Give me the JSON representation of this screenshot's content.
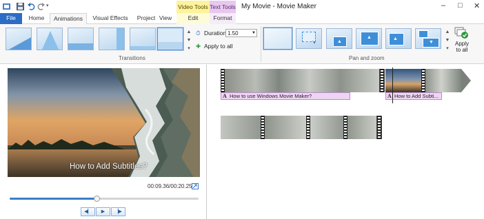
{
  "window": {
    "title": "My Movie - Movie Maker",
    "contextual": {
      "video_tools": "Video Tools",
      "text_tools": "Text Tools"
    }
  },
  "tabs": [
    {
      "label": "File"
    },
    {
      "label": "Home"
    },
    {
      "label": "Animations"
    },
    {
      "label": "Visual Effects"
    },
    {
      "label": "Project"
    },
    {
      "label": "View"
    },
    {
      "label": "Edit"
    },
    {
      "label": "Format"
    }
  ],
  "ribbon": {
    "transitions": {
      "group_label": "Transitions",
      "duration_label": "Duration:",
      "duration_value": "1.50",
      "apply_all_label": "Apply to all"
    },
    "pan_zoom": {
      "group_label": "Pan and zoom",
      "apply_all_label": "Apply to all"
    }
  },
  "preview": {
    "subtitle": "How to Add Subtitles?",
    "timecode": "00:09.36/00:20.25",
    "progress_fraction": 0.46
  },
  "storyboard": {
    "captions": [
      {
        "letter": "A",
        "text": "How to use Windows Movie Maker?"
      },
      {
        "letter": "A",
        "text": "How to Add Subti..."
      }
    ]
  },
  "colors": {
    "file_tab": "#2b6cc4",
    "video_tools": "#fcf39c",
    "text_tools": "#e8c8f0",
    "caption": "#efd5f4",
    "accent": "#3a7ec8"
  },
  "icons": [
    "save-icon",
    "undo-icon",
    "redo-icon",
    "minimize-icon",
    "maximize-icon",
    "close-icon",
    "play-icon",
    "previous-frame-icon",
    "next-frame-icon",
    "fullscreen-icon",
    "text-caption-icon"
  ]
}
